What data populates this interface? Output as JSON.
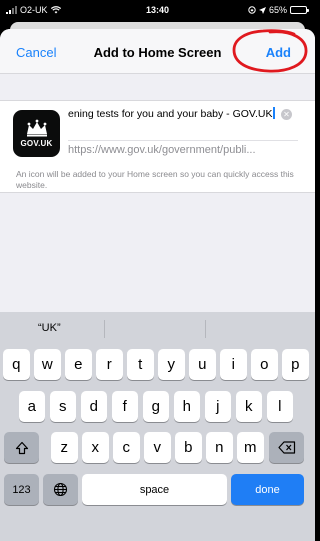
{
  "status_bar": {
    "carrier": "O2-UK",
    "time": "13:40",
    "battery": "65%",
    "battery_level": 0.65
  },
  "nav": {
    "cancel_label": "Cancel",
    "title": "Add to Home Screen",
    "add_label": "Add"
  },
  "shortcut": {
    "icon_text": "GOV.UK",
    "title_value": "ening tests for you and your baby - GOV.UK",
    "url": "https://www.gov.uk/government/publi..."
  },
  "hint": "An icon will be added to your Home screen so you can quickly access this website.",
  "keyboard": {
    "suggestion": "“UK”",
    "row1": [
      "q",
      "w",
      "e",
      "r",
      "t",
      "y",
      "u",
      "i",
      "o",
      "p"
    ],
    "row2": [
      "a",
      "s",
      "d",
      "f",
      "g",
      "h",
      "j",
      "k",
      "l"
    ],
    "row3": [
      "z",
      "x",
      "c",
      "v",
      "b",
      "n",
      "m"
    ],
    "numbers_label": "123",
    "space_label": "space",
    "done_label": "done"
  },
  "colors": {
    "accent": "#1a82fb",
    "annotation": "#e0191f",
    "done_key": "#1f7ef5"
  }
}
